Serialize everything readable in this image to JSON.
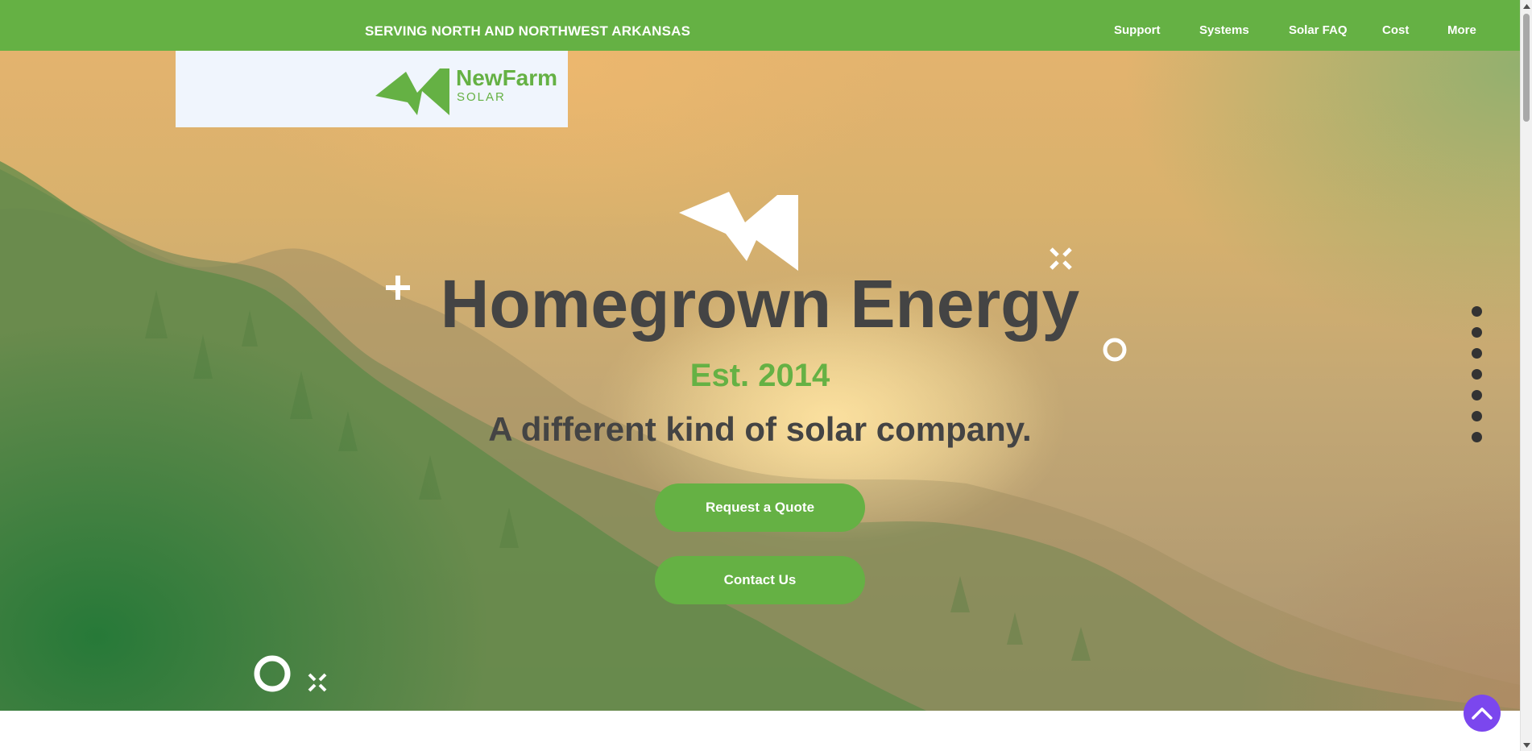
{
  "topbar": {
    "service_area": "SERVING NORTH AND NORTHWEST ARKANSAS",
    "nav": [
      {
        "label": "Support"
      },
      {
        "label": "Systems"
      },
      {
        "label": "Solar FAQ"
      },
      {
        "label": "Cost"
      },
      {
        "label": "More"
      }
    ]
  },
  "logo": {
    "brand": "NewFarm",
    "sub": "SOLAR",
    "icon": "newfarm-lightning-mark"
  },
  "hero": {
    "icon": "lightning-mark-icon",
    "headline": "Homegrown Energy",
    "established": "Est. 2014",
    "tagline": "A different kind of solar company.",
    "buttons": {
      "quote": "Request a Quote",
      "contact": "Contact Us"
    }
  },
  "section_nav": {
    "dot_count": 7,
    "icon": "section-dot-icon"
  },
  "back_to_top": {
    "icon": "chevron-up-icon"
  },
  "colors": {
    "brand_green": "#65b144",
    "text_dark": "#444444",
    "back_to_top": "#7b47ee",
    "logo_background": "#f0f5fd"
  }
}
